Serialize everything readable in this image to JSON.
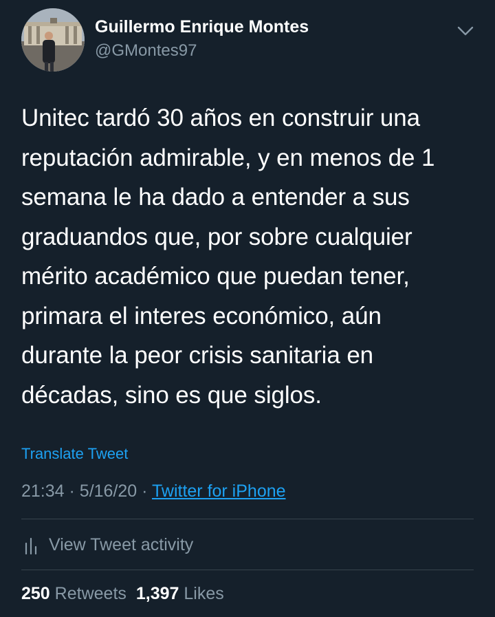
{
  "author": {
    "display_name": "Guillermo Enrique Montes",
    "handle": "@GMontes97"
  },
  "tweet": {
    "text": "Unitec tardó 30 años en construir una\nreputación admirable, y en menos de 1\nsemana le ha dado a entender a sus\ngraduandos que, por sobre cualquier\nmérito académico que puedan tener,\nprimara el interes económico, aún\ndurante la peor crisis sanitaria en\ndécadas, sino es que siglos.",
    "translate_label": "Translate Tweet",
    "time": "21:34",
    "separator": "·",
    "date": "5/16/20",
    "source": "Twitter for iPhone"
  },
  "activity": {
    "label": "View Tweet activity"
  },
  "stats": {
    "retweets_count": "250",
    "retweets_label": "Retweets",
    "likes_count": "1,397",
    "likes_label": "Likes"
  },
  "icons": {
    "menu": "chevron-down-icon",
    "activity": "bar-chart-icon"
  },
  "colors": {
    "background": "#15202b",
    "text_primary": "#ffffff",
    "text_secondary": "#8899a6",
    "accent": "#1da1f2",
    "divider": "#38444d"
  }
}
